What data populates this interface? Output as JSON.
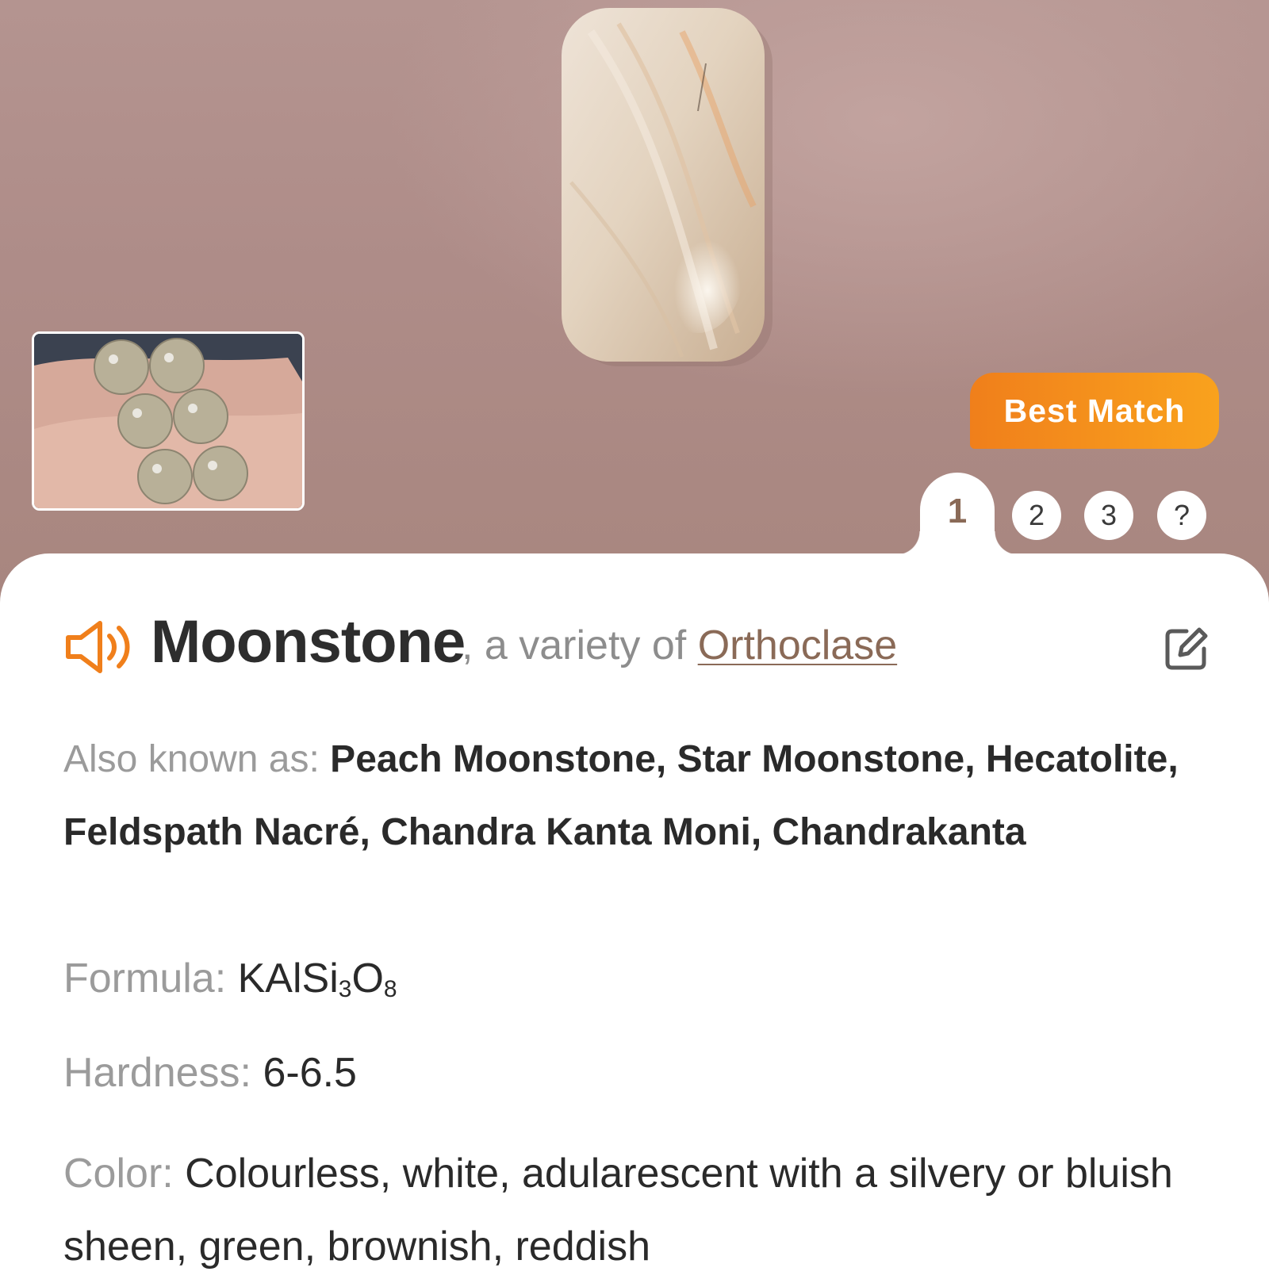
{
  "hero": {
    "badge": "Best Match"
  },
  "tabs": {
    "items": [
      "1",
      "2",
      "3",
      "?"
    ],
    "active": "1"
  },
  "mineral": {
    "name": "Moonstone",
    "variety_prefix": ", a variety of ",
    "variety_link": "Orthoclase"
  },
  "details": {
    "aka_label": "Also known as: ",
    "aka_value": "Peach Moonstone, Star Moonstone, Hecatolite, Feldspath Nacré, Chandra Kanta Moni, Chandrakanta",
    "formula_label": "Formula: ",
    "formula_main": "KAlSi",
    "formula_sub1": "3",
    "formula_mid": "O",
    "formula_sub2": "8",
    "hardness_label": "Hardness: ",
    "hardness_value": "6-6.5",
    "color_label": "Color: ",
    "color_value": "Colourless, white, adularescent with a silvery or bluish sheen, green, brownish, reddish"
  },
  "icons": {
    "speaker": "speaker-icon",
    "edit": "edit-icon"
  },
  "colors": {
    "accent": "#f07f1b",
    "link": "#8a6a57",
    "hero_bg": "#b08f8b"
  }
}
